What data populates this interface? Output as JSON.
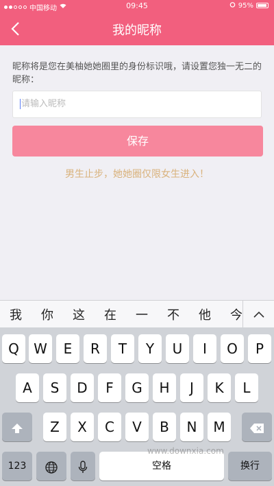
{
  "status": {
    "carrier": "中国移动",
    "time": "09:45",
    "battery": "95%"
  },
  "nav": {
    "title": "我的昵称"
  },
  "form": {
    "description": "昵称将是您在美柚她她圈里的身份标识哦，请设置您独一无二的昵称：",
    "input_placeholder": "请输入昵称",
    "save_label": "保存",
    "notice": "男生止步，她她圈仅限女生进入！"
  },
  "keyboard": {
    "candidates": [
      "我",
      "你",
      "这",
      "在",
      "一",
      "不",
      "他",
      "今"
    ],
    "row1": [
      "Q",
      "W",
      "E",
      "R",
      "T",
      "Y",
      "U",
      "I",
      "O",
      "P"
    ],
    "row2": [
      "A",
      "S",
      "D",
      "F",
      "G",
      "H",
      "J",
      "K",
      "L"
    ],
    "row3": [
      "Z",
      "X",
      "C",
      "V",
      "B",
      "N",
      "M"
    ],
    "numbers_label": "123",
    "space_label": "空格",
    "return_label": "换行"
  },
  "watermark": "www.downxia.com",
  "colors": {
    "header": "#f25f7e",
    "button": "#f7879d",
    "notice": "#d9b27c"
  }
}
